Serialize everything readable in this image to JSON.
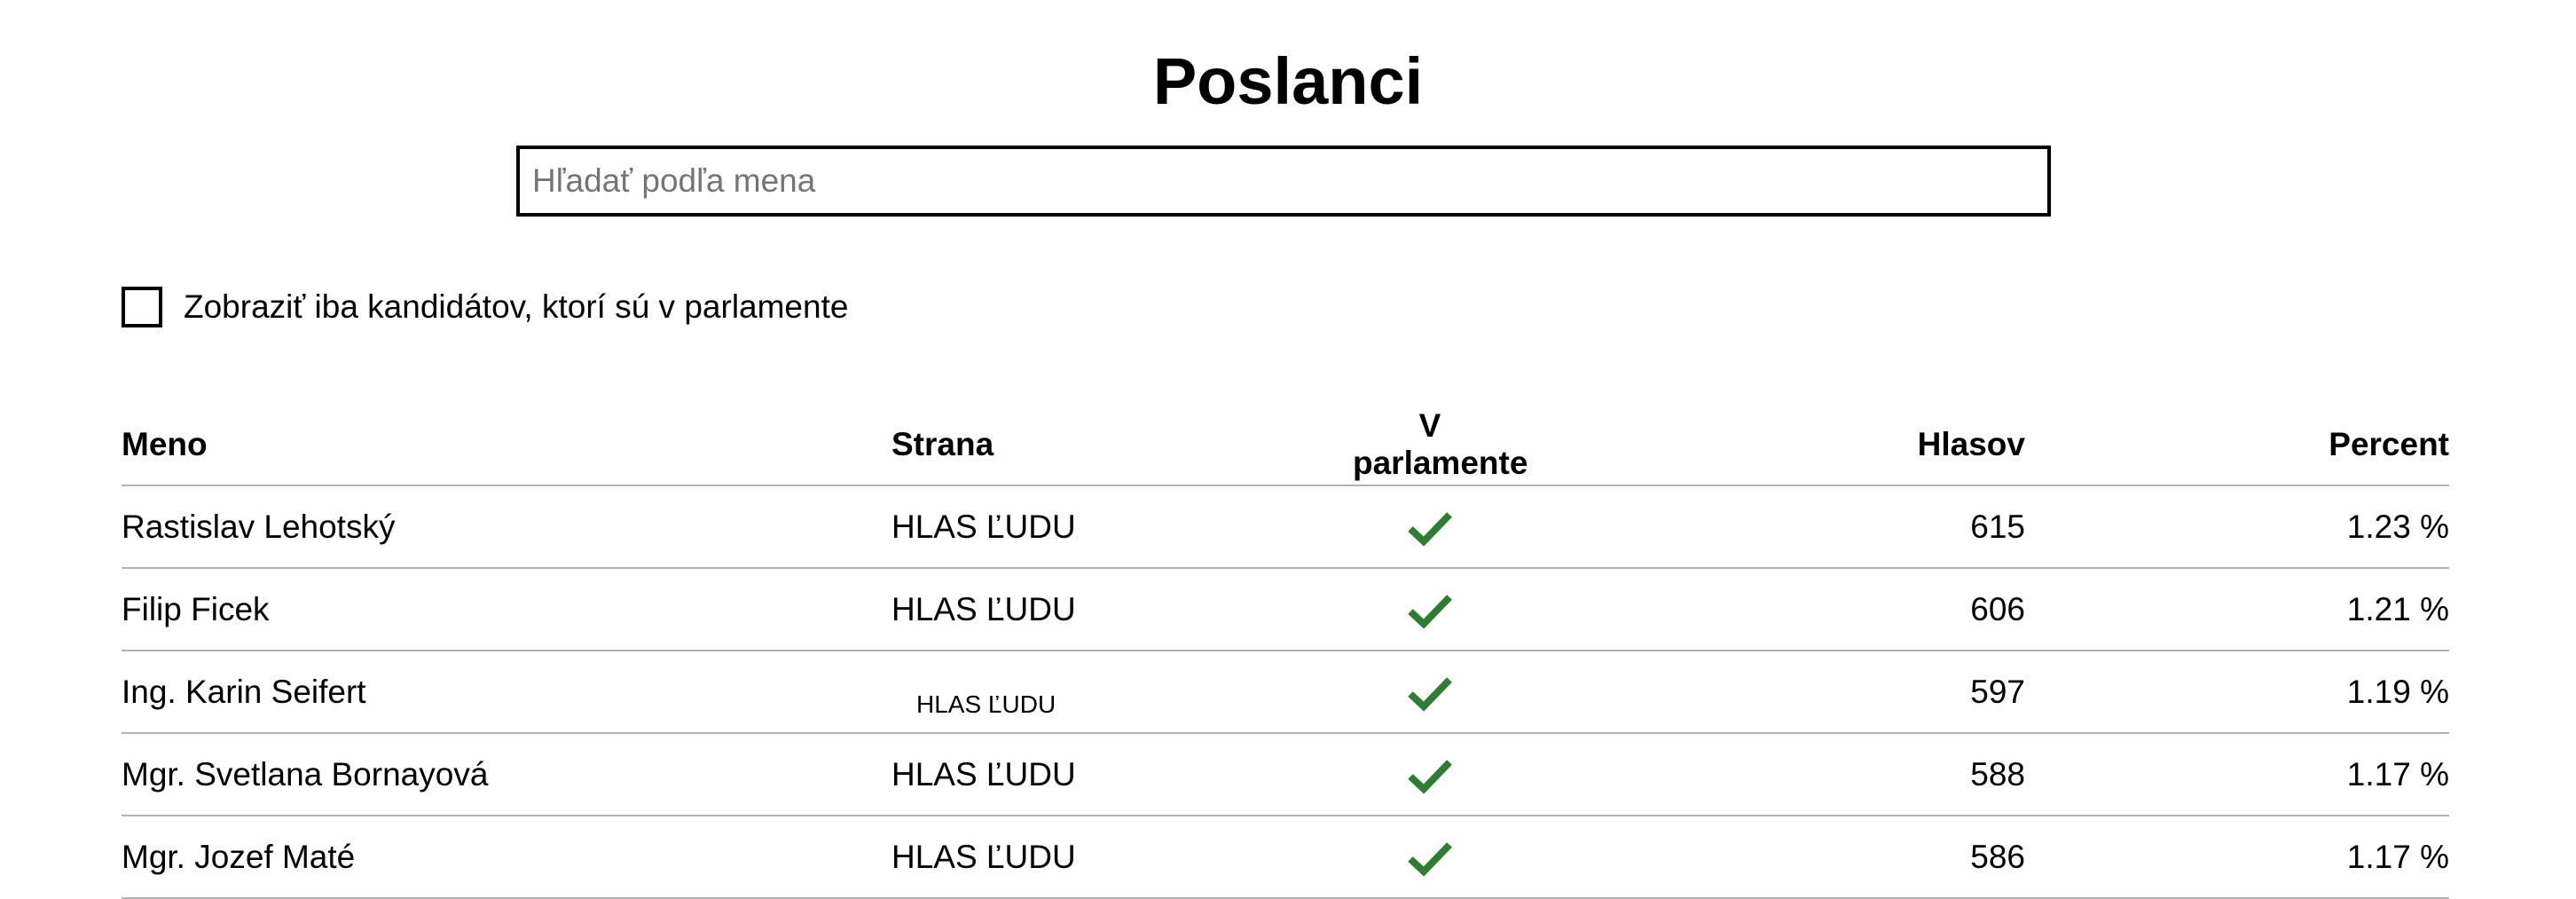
{
  "page": {
    "title": "Poslanci"
  },
  "search": {
    "placeholder": "Hľadať podľa mena",
    "value": ""
  },
  "filter": {
    "checkbox_label": "Zobraziť iba kandidátov, ktorí sú v parlamente",
    "checked": false
  },
  "table": {
    "headers": {
      "name": "Meno",
      "party": "Strana",
      "in_parliament": "V parlamente",
      "votes": "Hlasov",
      "percent": "Percent"
    },
    "rows": [
      {
        "name": "Rastislav Lehotský",
        "party": "HLAS ĽUDU",
        "in_parliament": true,
        "votes": "615",
        "percent": "1.23 %"
      },
      {
        "name": "Filip Ficek",
        "party": "HLAS ĽUDU",
        "in_parliament": true,
        "votes": "606",
        "percent": "1.21 %"
      },
      {
        "name": "Ing. Karin Seifert",
        "party": "HLAS ĽUDU",
        "in_parliament": true,
        "votes": "597",
        "percent": "1.19 %"
      },
      {
        "name": "Mgr. Svetlana Bornayová",
        "party": "HLAS ĽUDU",
        "in_parliament": true,
        "votes": "588",
        "percent": "1.17 %"
      },
      {
        "name": "Mgr. Jozef Maté",
        "party": "HLAS ĽUDU",
        "in_parliament": true,
        "votes": "586",
        "percent": "1.17 %"
      }
    ]
  },
  "icons": {
    "in_parliament": "checkmark-icon"
  },
  "colors": {
    "check": "#2e7d32",
    "text": "#000000",
    "divider": "#b3b3b3",
    "placeholder": "#757575"
  }
}
